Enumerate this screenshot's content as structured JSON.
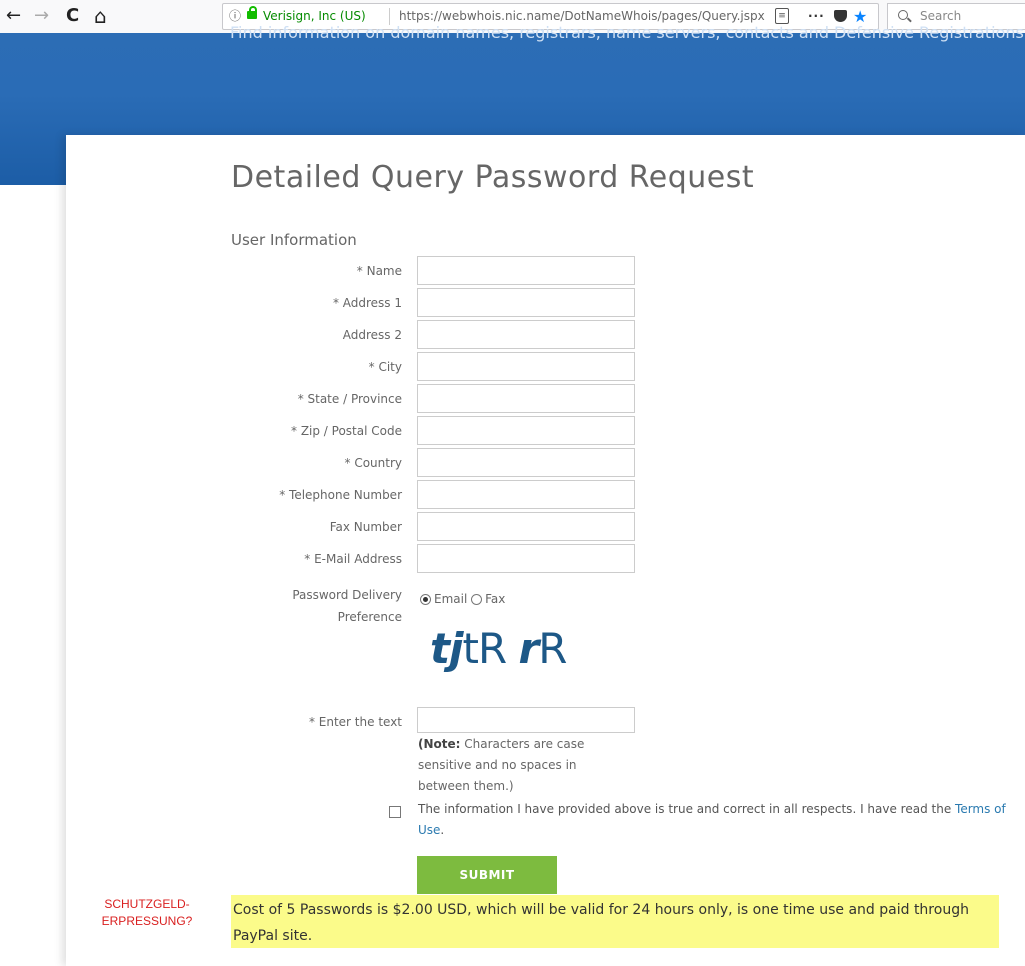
{
  "browser": {
    "back": "←",
    "forward": "→",
    "reload": "C",
    "home": "⌂",
    "info_icon": "ⓘ",
    "org_name": "Verisign, Inc (US)",
    "url": "https://webwhois.nic.name/DotNameWhois/pages/Query.jspx",
    "more": "···",
    "star": "★",
    "search_placeholder": "Search"
  },
  "banner": {
    "text": "Find information on domain names, registrars, name servers, contacts and Defensive Registrations"
  },
  "page": {
    "title": "Detailed Query Password Request",
    "section": "User Information"
  },
  "form": {
    "fields": [
      {
        "label": "* Name",
        "value": ""
      },
      {
        "label": "* Address 1",
        "value": ""
      },
      {
        "label": "Address 2",
        "value": ""
      },
      {
        "label": "* City",
        "value": ""
      },
      {
        "label": "* State / Province",
        "value": ""
      },
      {
        "label": "* Zip / Postal Code",
        "value": ""
      },
      {
        "label": "* Country",
        "value": ""
      },
      {
        "label": "* Telephone Number",
        "value": ""
      },
      {
        "label": "Fax Number",
        "value": ""
      },
      {
        "label": "* E-Mail Address",
        "value": ""
      }
    ],
    "pref_label_1": "Password Delivery",
    "pref_label_2": "Preference",
    "option_email": "Email",
    "option_fax": "Fax",
    "captcha_1": "tj",
    "captcha_2": "tR ",
    "captcha_3": "r",
    "captcha_4": "R",
    "captcha_label": "* Enter the text",
    "note_bold": "(Note:",
    "note_text": " Characters are case sensitive and no spaces in between them.)",
    "terms_text": "The information I have provided above is true and correct in all respects. I have read the ",
    "terms_link": "Terms of Use",
    "terms_end": ".",
    "submit": "SUBMIT"
  },
  "annotation": {
    "line1": "SCHUTZGELD-",
    "line2": "ERPRESSUNG?",
    "highlight": "Cost of 5 Passwords is $2.00 USD, which will be valid for 24 hours only, is one time use and paid through PayPal site."
  }
}
